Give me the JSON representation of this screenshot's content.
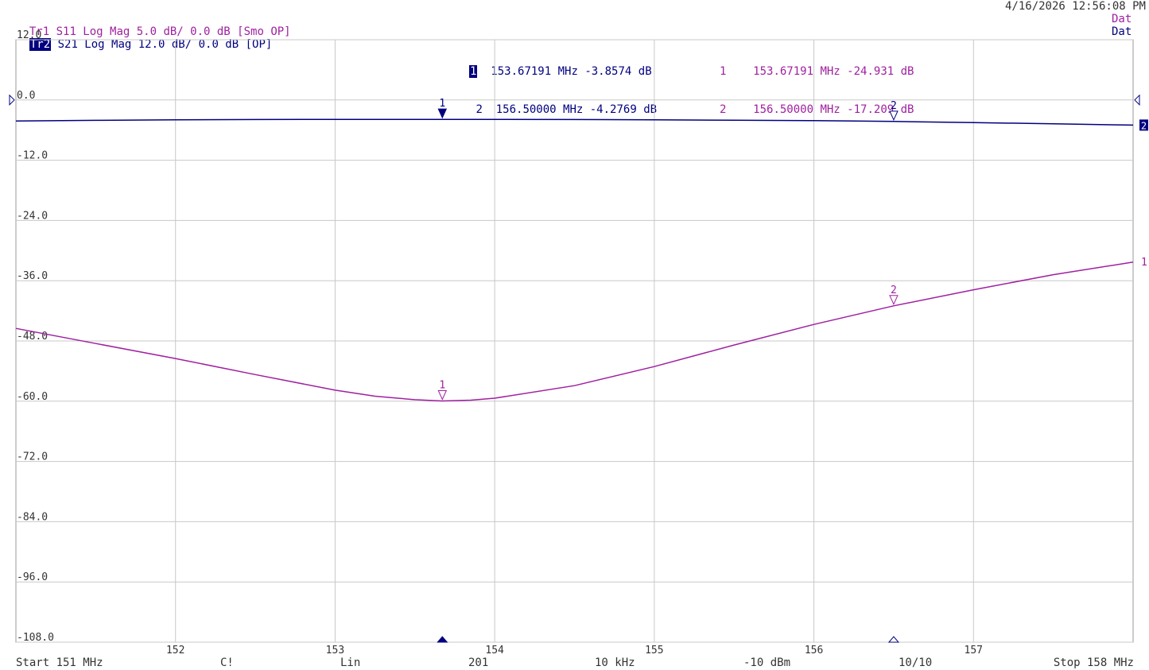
{
  "header": {
    "datetime": "4/16/2026 12:56:08 PM",
    "traces": [
      {
        "id": "Tr1",
        "text": "S11 Log Mag 5.0 dB/ 0.0 dB [Smo OP]",
        "status": "Dat"
      },
      {
        "id": "Tr2",
        "text": "S21 Log Mag 12.0 dB/ 0.0 dB [OP]",
        "status": "Dat"
      }
    ]
  },
  "markers_s21": [
    {
      "num": "1",
      "freq": "153.67191 MHz",
      "val": "-3.8574",
      "unit": "dB"
    },
    {
      "num": "2",
      "freq": "156.50000 MHz",
      "val": "-4.2769",
      "unit": "dB"
    }
  ],
  "markers_s11": [
    {
      "num": "1",
      "freq": "153.67191 MHz",
      "val": "-24.931",
      "unit": "dB"
    },
    {
      "num": "2",
      "freq": "156.50000 MHz",
      "val": "-17.209",
      "unit": "dB"
    }
  ],
  "footer": {
    "start": "Start 151 MHz",
    "cal": "C!",
    "sweep": "Lin",
    "points": "201",
    "ifbw": "10 kHz",
    "power": "-10 dBm",
    "avg": "10/10",
    "stop": "Stop 158 MHz"
  },
  "colors": {
    "s11": "#a020a0",
    "s21": "#000080",
    "grid": "#c8c8c8"
  },
  "chart_data": {
    "type": "line",
    "xlim": [
      151,
      158
    ],
    "ylim": [
      -108,
      12
    ],
    "x_ticks": [
      152,
      153,
      154,
      155,
      156,
      157
    ],
    "x_tick_labels": [
      "152",
      "153",
      "154",
      "155",
      "156",
      "157"
    ],
    "y_ticks": [
      12,
      0,
      -12,
      -24,
      -36,
      -48,
      -60,
      -72,
      -84,
      -96,
      -108
    ],
    "y_tick_labels": [
      "12.0",
      "0.0",
      "-12.0",
      "-24.0",
      "-36.0",
      "-48.0",
      "-60.0",
      "-72.0",
      "-84.0",
      "-96.0",
      "-108.0"
    ],
    "grid": true,
    "series": [
      {
        "key": "s21",
        "label": "2",
        "x": [
          151,
          151.5,
          152,
          152.5,
          153,
          153.5,
          154,
          154.5,
          155,
          155.5,
          156,
          156.5,
          157,
          157.5,
          158
        ],
        "y": [
          -4.2,
          -4.05,
          -3.95,
          -3.9,
          -3.87,
          -3.86,
          -3.86,
          -3.9,
          -3.95,
          -4.02,
          -4.12,
          -4.28,
          -4.5,
          -4.75,
          -5.0
        ]
      },
      {
        "key": "s11",
        "label": "1",
        "x": [
          151,
          151.5,
          152,
          152.5,
          153,
          153.25,
          153.5,
          153.67,
          153.85,
          154,
          154.5,
          155,
          155.5,
          156,
          156.5,
          157,
          157.5,
          158
        ],
        "y": [
          -45.5,
          -48.5,
          -51.5,
          -54.7,
          -57.8,
          -59.0,
          -59.7,
          -59.95,
          -59.8,
          -59.4,
          -56.9,
          -53.1,
          -48.8,
          -44.7,
          -41.0,
          -37.8,
          -34.8,
          -32.3
        ]
      }
    ],
    "markers": [
      {
        "series": "s21",
        "num": "1",
        "x": 153.67191,
        "y": -3.8574,
        "active": true
      },
      {
        "series": "s21",
        "num": "2",
        "x": 156.5,
        "y": -4.2769,
        "active": false
      },
      {
        "series": "s11",
        "num": "1",
        "x": 153.67191,
        "y": -59.95,
        "active": false
      },
      {
        "series": "s11",
        "num": "2",
        "x": 156.5,
        "y": -41.0,
        "active": false
      }
    ]
  }
}
